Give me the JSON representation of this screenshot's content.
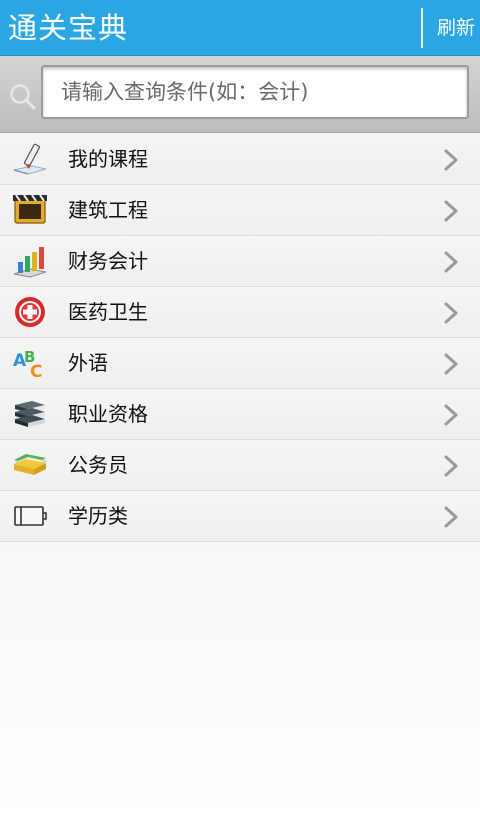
{
  "header": {
    "title": "通关宝典",
    "refresh_label": "刷新"
  },
  "search": {
    "placeholder": "请输入查询条件(如：会计)",
    "value": ""
  },
  "menu": {
    "items": [
      {
        "label": "我的课程",
        "icon": "pencil-paper-icon"
      },
      {
        "label": "建筑工程",
        "icon": "film-clapper-icon"
      },
      {
        "label": "财务会计",
        "icon": "bar-chart-icon"
      },
      {
        "label": "医药卫生",
        "icon": "medical-cross-icon"
      },
      {
        "label": "外语",
        "icon": "abc-letters-icon"
      },
      {
        "label": "职业资格",
        "icon": "book-stack-icon"
      },
      {
        "label": "公务员",
        "icon": "folder-icon"
      },
      {
        "label": "学历类",
        "icon": "book-icon"
      }
    ]
  },
  "colors": {
    "header_bg": "#2aa7e2",
    "chevron": "#9a9a9a"
  }
}
